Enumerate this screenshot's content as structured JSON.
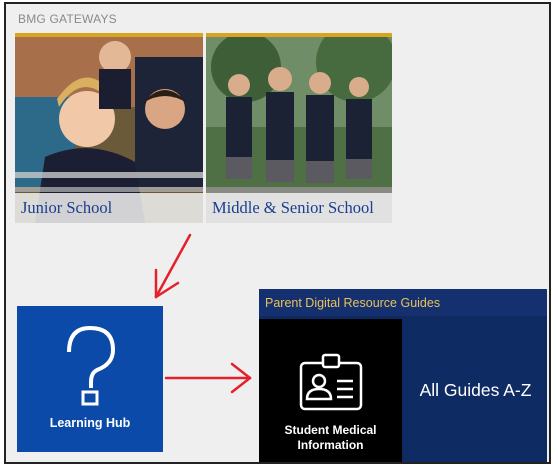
{
  "section": {
    "label": "BMG GATEWAYS"
  },
  "gateways": [
    {
      "label": "Junior School"
    },
    {
      "label": "Middle & Senior School"
    }
  ],
  "learning_hub": {
    "label": "Learning Hub",
    "icon": "question-mark-icon"
  },
  "guides": {
    "header": "Parent Digital Resource Guides",
    "medical_label_line1": "Student Medical",
    "medical_label_line2": "Information",
    "medical_icon": "id-card-icon",
    "az_label": "All Guides A-Z"
  },
  "colors": {
    "accent_gold": "#d9a520",
    "hub_blue": "#0b4aa8",
    "navy": "#0f2a60",
    "header_text": "#e8c25a",
    "caption_blue": "#1b3e8f",
    "annotation_red": "#e5202a"
  }
}
